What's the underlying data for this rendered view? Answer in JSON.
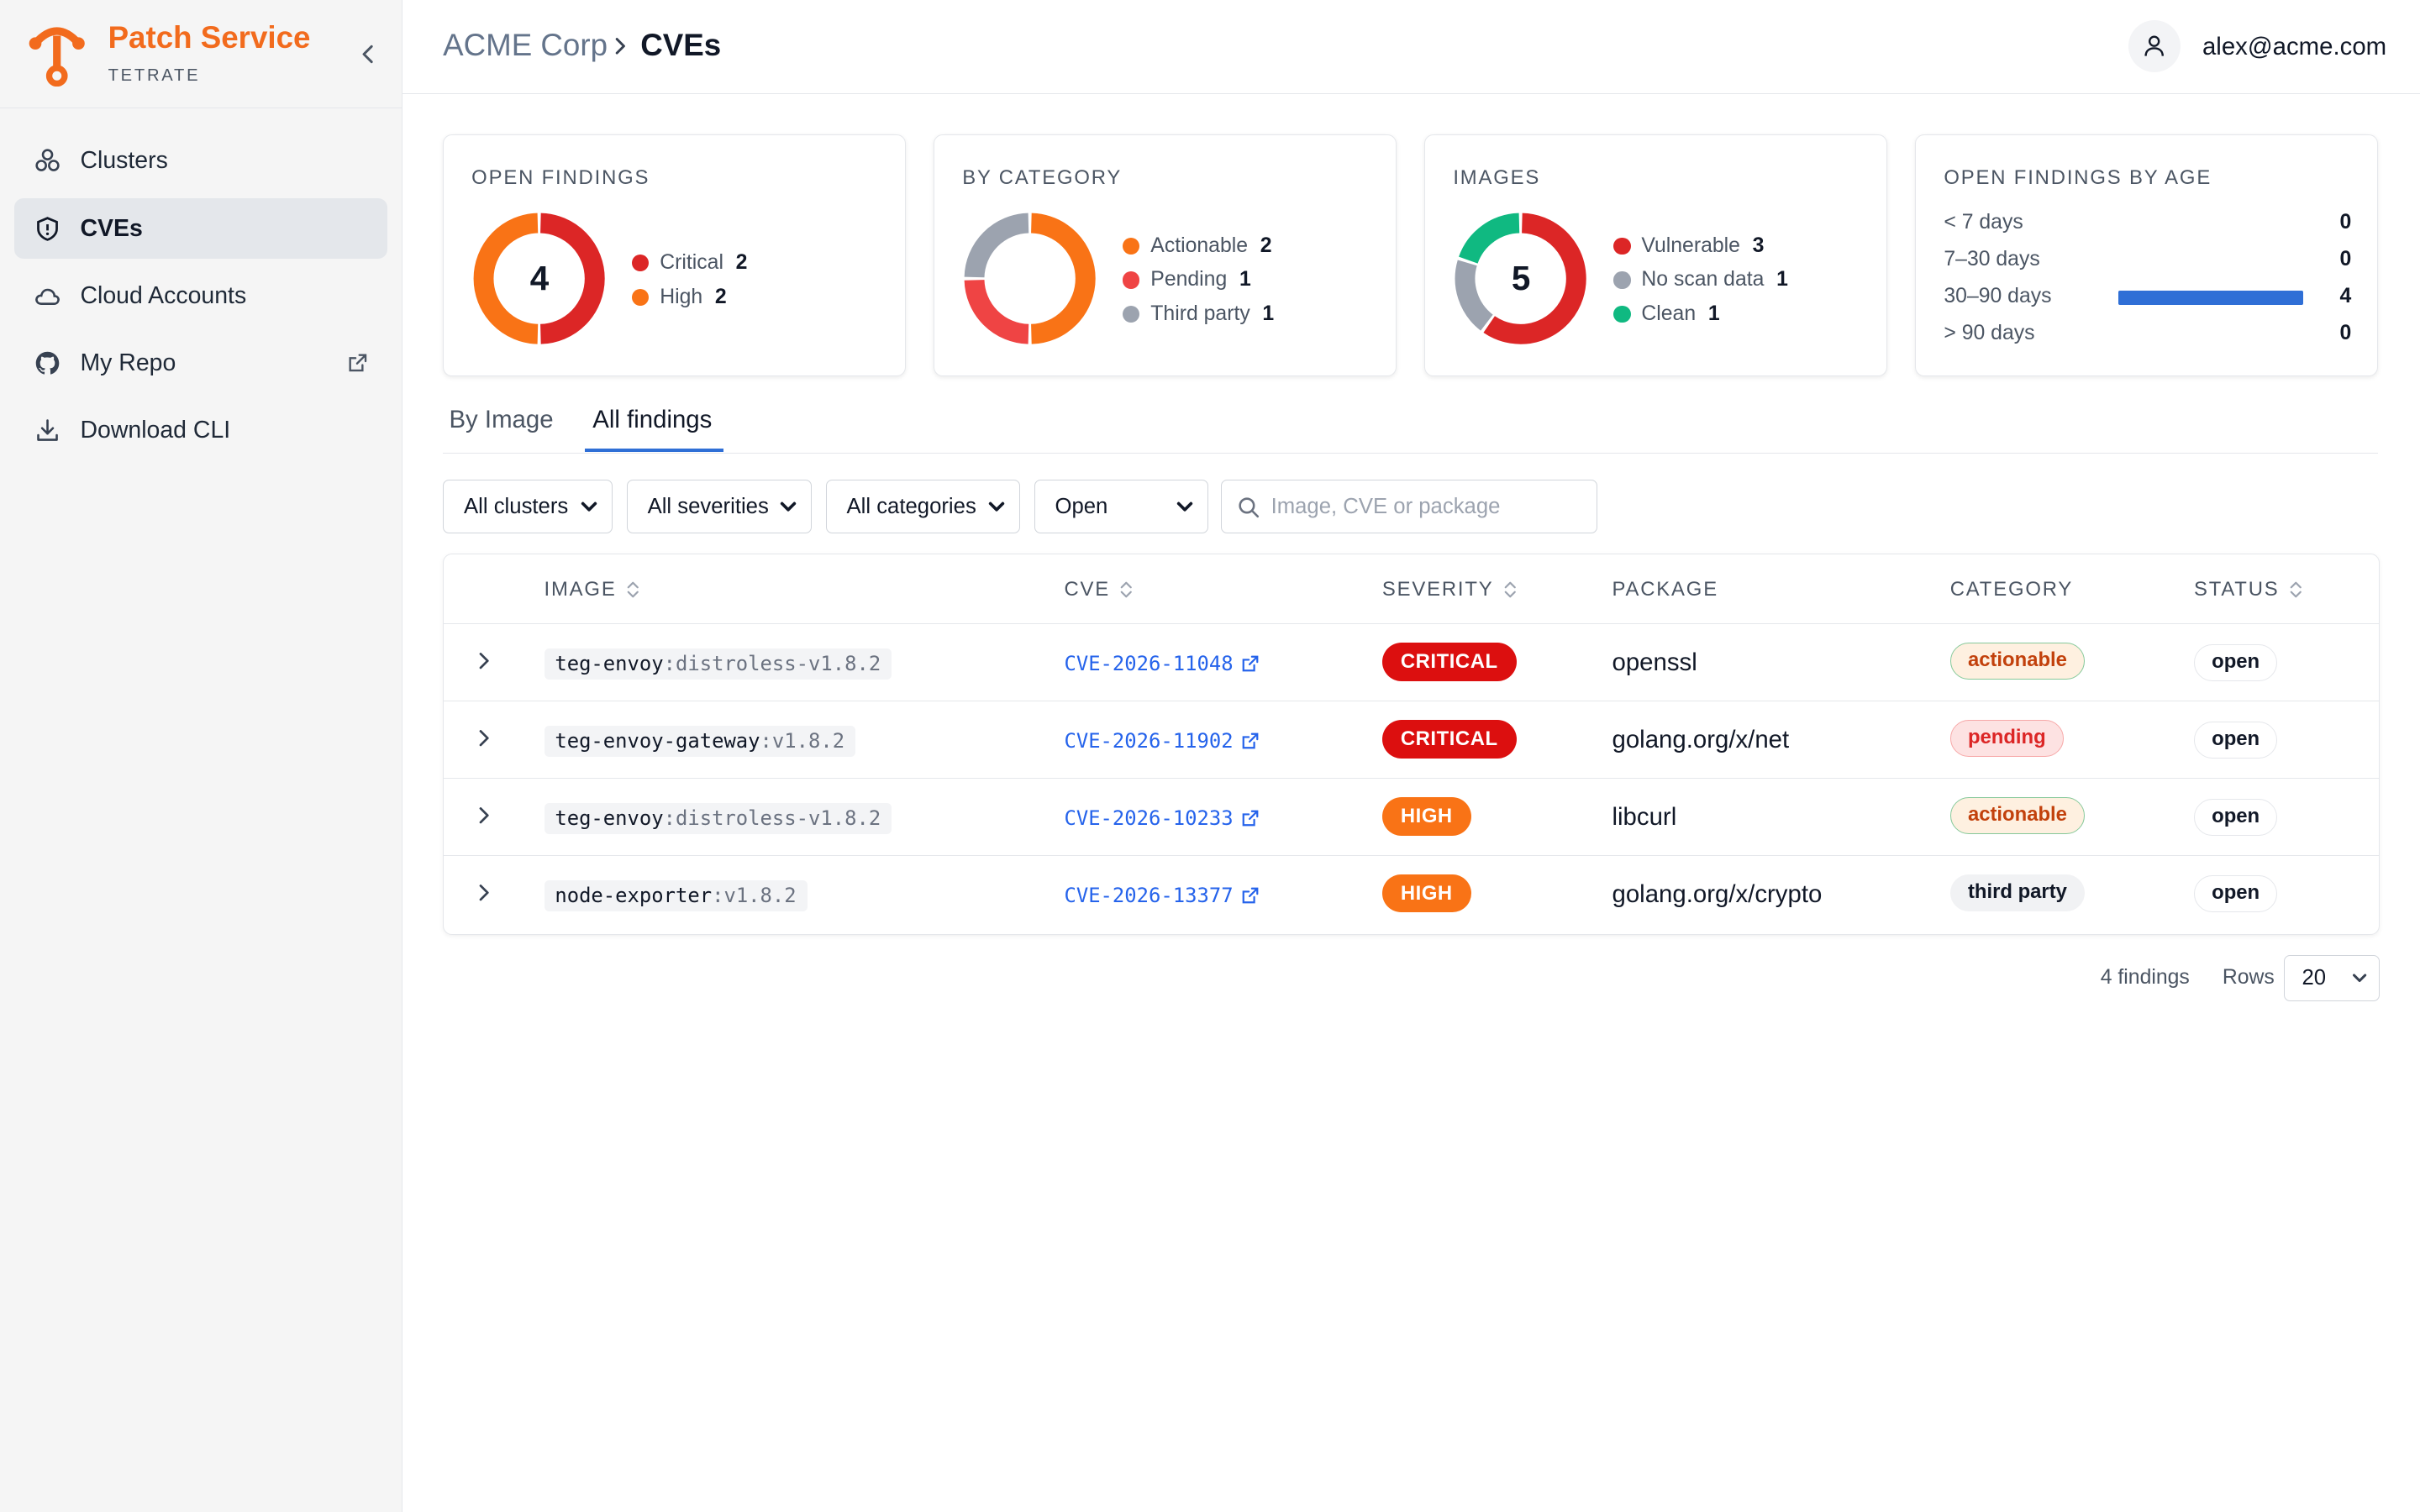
{
  "brand": {
    "title": "Patch Service",
    "subtitle": "TETRATE",
    "color": "#f26b1d"
  },
  "sidebar": {
    "items": [
      {
        "label": "Clusters",
        "icon": "clusters-icon",
        "active": false
      },
      {
        "label": "CVEs",
        "icon": "shield-icon",
        "active": true
      },
      {
        "label": "Cloud Accounts",
        "icon": "cloud-icon",
        "active": false
      },
      {
        "label": "My Repo",
        "icon": "github-icon",
        "active": false,
        "external": true
      },
      {
        "label": "Download CLI",
        "icon": "download-icon",
        "active": false
      }
    ]
  },
  "header": {
    "breadcrumb_parent": "ACME Corp",
    "breadcrumb_current": "CVEs",
    "user_email": "alex@acme.com"
  },
  "cards": {
    "open_findings": {
      "title": "OPEN FINDINGS",
      "total": "4",
      "legend": [
        {
          "label": "Critical",
          "count": "2",
          "value": 2,
          "color": "#dc2626"
        },
        {
          "label": "High",
          "count": "2",
          "value": 2,
          "color": "#f97316"
        }
      ]
    },
    "by_category": {
      "title": "BY CATEGORY",
      "legend": [
        {
          "label": "Actionable",
          "count": "2",
          "value": 2,
          "color": "#f97316"
        },
        {
          "label": "Pending",
          "count": "1",
          "value": 1,
          "color": "#ef4444"
        },
        {
          "label": "Third party",
          "count": "1",
          "value": 1,
          "color": "#9ca3af"
        }
      ]
    },
    "images": {
      "title": "IMAGES",
      "total": "5",
      "legend": [
        {
          "label": "Vulnerable",
          "count": "3",
          "value": 3,
          "color": "#dc2626"
        },
        {
          "label": "No scan data",
          "count": "1",
          "value": 1,
          "color": "#9ca3af"
        },
        {
          "label": "Clean",
          "count": "1",
          "value": 1,
          "color": "#10b981"
        }
      ]
    },
    "by_age": {
      "title": "OPEN FINDINGS BY AGE",
      "rows": [
        {
          "label": "< 7 days",
          "count": "0",
          "value": 0
        },
        {
          "label": "7–30 days",
          "count": "0",
          "value": 0
        },
        {
          "label": "30–90 days",
          "count": "4",
          "value": 4
        },
        {
          "label": "> 90 days",
          "count": "0",
          "value": 0
        }
      ],
      "bar_color": "#2f6fd6"
    }
  },
  "tabs": [
    {
      "label": "By Image",
      "active": false
    },
    {
      "label": "All findings",
      "active": true
    }
  ],
  "filters": {
    "cluster": "All clusters",
    "severity": "All severities",
    "category": "All categories",
    "status": "Open",
    "search_placeholder": "Image, CVE or package"
  },
  "table": {
    "columns": [
      "IMAGE",
      "CVE",
      "SEVERITY",
      "PACKAGE",
      "CATEGORY",
      "STATUS"
    ],
    "rows": [
      {
        "image_name": "teg-envoy",
        "image_tag": ":distroless-v1.8.2",
        "cve": "CVE-2026-11048",
        "severity": "CRITICAL",
        "package": "openssl",
        "category": "actionable",
        "status": "open"
      },
      {
        "image_name": "teg-envoy-gateway",
        "image_tag": ":v1.8.2",
        "cve": "CVE-2026-11902",
        "severity": "CRITICAL",
        "package": "golang.org/x/net",
        "category": "pending",
        "status": "open"
      },
      {
        "image_name": "teg-envoy",
        "image_tag": ":distroless-v1.8.2",
        "cve": "CVE-2026-10233",
        "severity": "HIGH",
        "package": "libcurl",
        "category": "actionable",
        "status": "open"
      },
      {
        "image_name": "node-exporter",
        "image_tag": ":v1.8.2",
        "cve": "CVE-2026-13377",
        "severity": "HIGH",
        "package": "golang.org/x/crypto",
        "category": "third party",
        "status": "open"
      }
    ]
  },
  "severity_colors": {
    "CRITICAL": "#dc0f0f",
    "HIGH": "#f97316"
  },
  "category_styles": {
    "actionable": {
      "bg": "#fef0e0",
      "border": "#86c99a",
      "color": "#c2410c"
    },
    "pending": {
      "bg": "#fde2e2",
      "border": "#f7a8a8",
      "color": "#dc2626"
    },
    "third party": {
      "bg": "#f1f2f4",
      "border": "#f1f2f4",
      "color": "#111827"
    }
  },
  "footer": {
    "findings_count": "4 findings",
    "rows_label": "Rows",
    "rows_value": "20"
  }
}
